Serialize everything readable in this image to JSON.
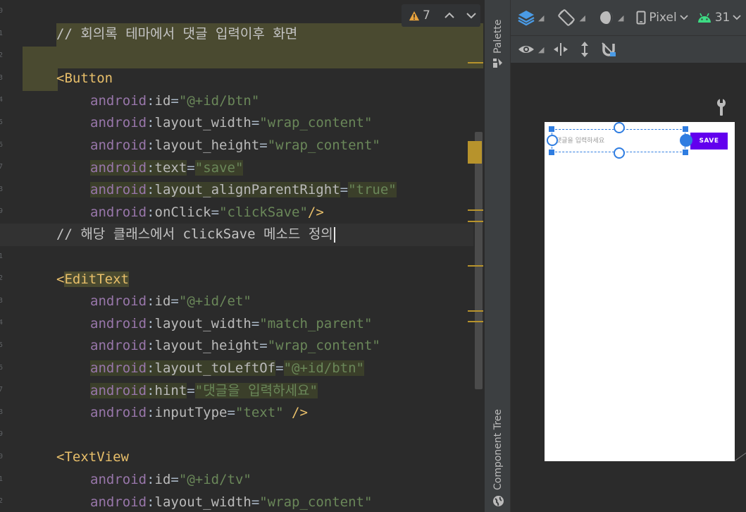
{
  "editor": {
    "lines": [
      {
        "type": "comment",
        "text": "// 회의록 테마에서 댓글 입력이후 화면"
      },
      {
        "type": "blank"
      },
      {
        "type": "open",
        "tag": "Button"
      },
      {
        "type": "attr",
        "ns": "android",
        "name": "id",
        "value": "\"@+id/btn\""
      },
      {
        "type": "attr",
        "ns": "android",
        "name": "layout_width",
        "value": "\"wrap_content\""
      },
      {
        "type": "attr",
        "ns": "android",
        "name": "layout_height",
        "value": "\"wrap_content\""
      },
      {
        "type": "attr",
        "ns": "android",
        "name": "text",
        "value": "\"save\"",
        "warn": true
      },
      {
        "type": "attr",
        "ns": "android",
        "name": "layout_alignParentRight",
        "value": "\"true\"",
        "warn": true
      },
      {
        "type": "attr",
        "ns": "android",
        "name": "onClick",
        "value": "\"clickSave\"",
        "close": "/>"
      },
      {
        "type": "comment",
        "text": "// 해당 클래스에서 clickSave 메소드 정의",
        "current": true
      },
      {
        "type": "blank"
      },
      {
        "type": "open",
        "tag": "EditText",
        "boxed": true
      },
      {
        "type": "attr",
        "ns": "android",
        "name": "id",
        "value": "\"@+id/et\""
      },
      {
        "type": "attr",
        "ns": "android",
        "name": "layout_width",
        "value": "\"match_parent\""
      },
      {
        "type": "attr",
        "ns": "android",
        "name": "layout_height",
        "value": "\"wrap_content\""
      },
      {
        "type": "attr",
        "ns": "android",
        "name": "layout_toLeftOf",
        "value": "\"@+id/btn\"",
        "warn": true
      },
      {
        "type": "attr",
        "ns": "android",
        "name": "hint",
        "value": "\"댓글을 입력하세요\"",
        "warn": true
      },
      {
        "type": "attr",
        "ns": "android",
        "name": "inputType",
        "value": "\"text\"",
        "close": " />"
      },
      {
        "type": "blank"
      },
      {
        "type": "open",
        "tag": "TextView"
      },
      {
        "type": "attr",
        "ns": "android",
        "name": "id",
        "value": "\"@+id/tv\""
      },
      {
        "type": "attr",
        "ns": "android",
        "name": "layout_width",
        "value": "\"wrap_content\""
      }
    ],
    "gutter_numbers": [
      "0",
      "1",
      "2",
      "3",
      "4",
      "5",
      "6",
      "7",
      "8",
      "9",
      "0",
      "1",
      "2",
      "3",
      "4",
      "5",
      "6",
      "7",
      "8",
      "9",
      "0",
      "1",
      "2"
    ],
    "warnings": {
      "count": "7",
      "prev": "^",
      "next": "v"
    }
  },
  "side_strip": {
    "palette_label": "Palette",
    "component_tree_label": "Component Tree"
  },
  "toolbar": {
    "device": "Pixel",
    "api": "31"
  },
  "preview": {
    "hint": "댓글을 입력하세요",
    "button_label": "SAVE"
  },
  "colors": {
    "accent": "#2f7de1",
    "button": "#6200ee",
    "android_green": "#3ddc84",
    "warning": "#e8a33d"
  }
}
